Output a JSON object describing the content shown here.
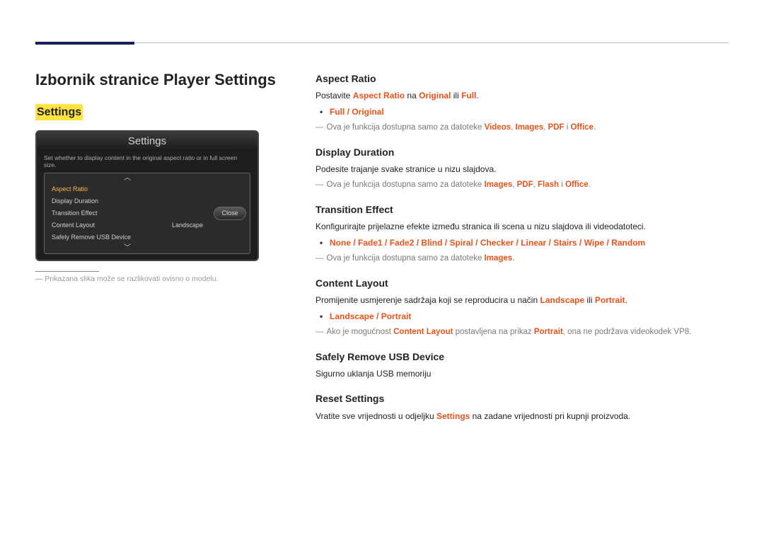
{
  "page_title": "Izbornik stranice Player Settings",
  "highlight_label": "Settings",
  "panel": {
    "title": "Settings",
    "desc": "Set whether to display content in the original aspect ratio or in full screen size.",
    "rows": {
      "aspect": "Aspect Ratio",
      "duration": "Display Duration",
      "transition": "Transition Effect",
      "layout": "Content Layout",
      "layout_val": "Landscape",
      "usb": "Safely Remove USB Device"
    },
    "close": "Close"
  },
  "caption": {
    "dash": "―",
    "text": " Prikazana slika može se razlikovati ovisno o modelu."
  },
  "aspect": {
    "h": "Aspect Ratio",
    "p1a": "Postavite ",
    "p1b": "Aspect Ratio",
    "p1c": " na ",
    "p1d": "Original",
    "p1e": " ili ",
    "p1f": "Full",
    "p1g": ".",
    "opt1": "Full",
    "opt_sep": " / ",
    "opt2": "Original",
    "n1a": "Ova je funkcija dostupna samo za datoteke ",
    "n1b": "Videos",
    "n1c": ", ",
    "n1d": "Images",
    "n1e": ", ",
    "n1f": "PDF",
    "n1g": " i ",
    "n1h": "Office",
    "n1i": "."
  },
  "duration": {
    "h": "Display Duration",
    "p1": "Podesite trajanje svake stranice u nizu slajdova.",
    "n1a": "Ova je funkcija dostupna samo za datoteke ",
    "n1b": "Images",
    "n1c": ", ",
    "n1d": "PDF",
    "n1e": ", ",
    "n1f": "Flash",
    "n1g": " i ",
    "n1h": "Office",
    "n1i": "."
  },
  "transition": {
    "h": "Transition Effect",
    "p1": "Konfigurirajte prijelazne efekte između stranica ili scena u nizu slajdova ili videodatoteci.",
    "o1": "None",
    "o2": "Fade1",
    "o3": "Fade2",
    "o4": "Blind",
    "o5": "Spiral",
    "o6": "Checker",
    "o7": "Linear",
    "o8": "Stairs",
    "o9": "Wipe",
    "o10": "Random",
    "sep": " / ",
    "n1a": "Ova je funkcija dostupna samo za datoteke ",
    "n1b": "Images",
    "n1c": "."
  },
  "layout": {
    "h": "Content Layout",
    "p1a": "Promijenite usmjerenje sadržaja koji se reproducira u način ",
    "p1b": "Landscape",
    "p1c": " ili ",
    "p1d": "Portrait",
    "p1e": ".",
    "o1": "Landscape",
    "sep": " / ",
    "o2": "Portrait",
    "n1a": "Ako je mogućnost ",
    "n1b": "Content Layout",
    "n1c": " postavljena na prikaz ",
    "n1d": "Portrait",
    "n1e": ", ona ne podržava videokodek VP8."
  },
  "usb": {
    "h": "Safely Remove USB Device",
    "p1": "Sigurno uklanja USB memoriju"
  },
  "reset": {
    "h": "Reset Settings",
    "p1a": "Vratite sve vrijednosti u odjeljku ",
    "p1b": "Settings",
    "p1c": " na zadane vrijednosti pri kupnji proizvoda."
  },
  "dash": "―"
}
